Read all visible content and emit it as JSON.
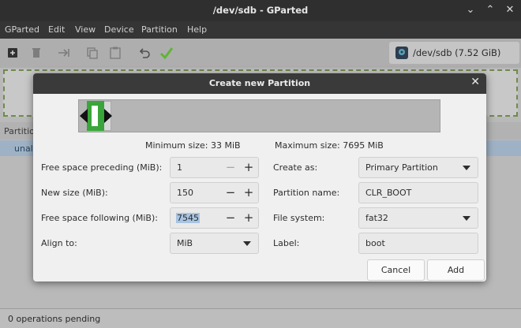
{
  "window": {
    "title": "/dev/sdb - GParted"
  },
  "menu": [
    "GParted",
    "Edit",
    "View",
    "Device",
    "Partition",
    "Help"
  ],
  "device": {
    "label": "/dev/sdb (7.52 GiB)"
  },
  "partitions": {
    "header": "Partitio",
    "row_label": "unal"
  },
  "status": {
    "text": "0 operations pending"
  },
  "dialog": {
    "title": "Create new Partition",
    "min_size": "Minimum size: 33 MiB",
    "max_size": "Maximum size: 7695 MiB",
    "free_preceding": {
      "label": "Free space preceding (MiB):",
      "value": "1"
    },
    "new_size": {
      "label": "New size (MiB):",
      "value": "150"
    },
    "free_following": {
      "label": "Free space following (MiB):",
      "value": "7545"
    },
    "align_to": {
      "label": "Align to:",
      "value": "MiB"
    },
    "create_as": {
      "label": "Create as:",
      "value": "Primary Partition"
    },
    "partition_name": {
      "label": "Partition name:",
      "value": "CLR_BOOT"
    },
    "file_system": {
      "label": "File system:",
      "value": "fat32"
    },
    "fs_label": {
      "label": "Label:",
      "value": "boot"
    },
    "cancel": "Cancel",
    "add": "Add"
  },
  "icons": [
    "new-icon",
    "delete-icon",
    "resize-move-icon",
    "copy-icon",
    "paste-icon",
    "undo-icon",
    "apply-icon",
    "disk-icon"
  ],
  "colors": {
    "partition_fill": "#3aa53a",
    "selection": "#a8c4e2",
    "disk_border": "#6f8a4e"
  }
}
